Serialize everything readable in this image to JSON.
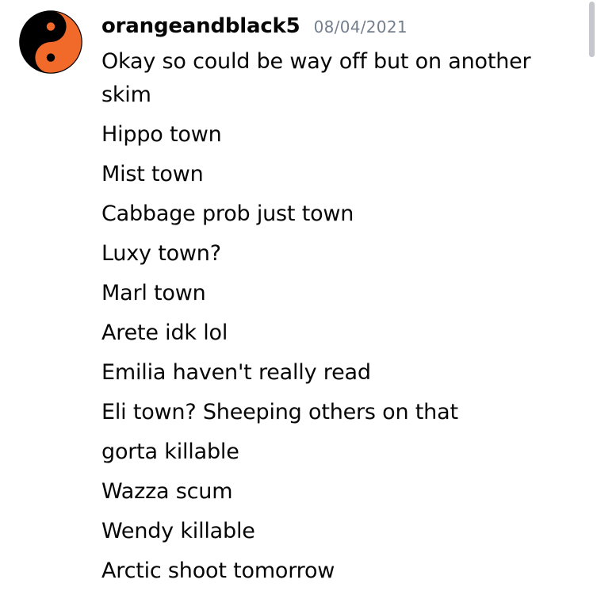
{
  "message": {
    "avatar_icon": "yin-yang-icon",
    "avatar_colors": {
      "dark": "#000000",
      "light": "#f26a2a"
    },
    "username": "orangeandblack5",
    "timestamp": "08/04/2021",
    "lines": [
      "Okay so could be way off but on another skim",
      "Hippo town",
      "Mist town",
      "Cabbage prob just town",
      "Luxy town?",
      "Marl town",
      "Arete idk lol",
      "Emilia haven't really read",
      "Eli town? Sheeping others on that",
      "gorta killable",
      "Wazza scum",
      "Wendy killable",
      "Arctic shoot tomorrow"
    ]
  }
}
